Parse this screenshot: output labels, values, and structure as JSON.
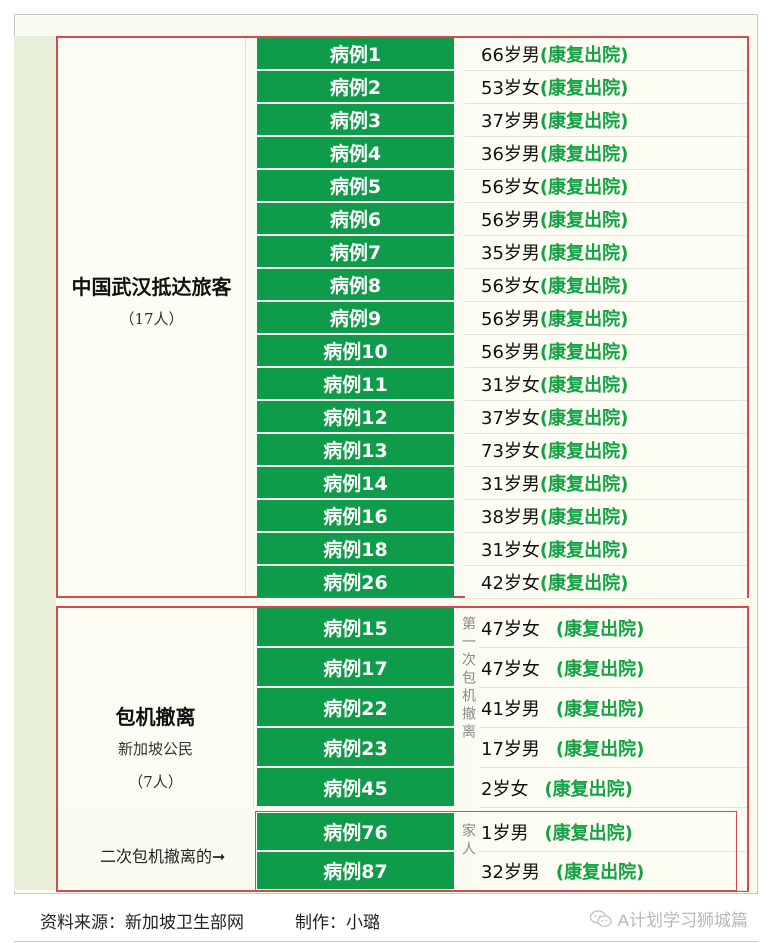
{
  "colors": {
    "accent_green": "#0e9c4a",
    "status_green": "#14a244",
    "border_red": "#d5494f"
  },
  "group1": {
    "title": "中国武汉抵达旅客",
    "count": "（17人）",
    "rows": [
      {
        "case": "病例1",
        "info": "66岁男",
        "status": "(康复出院)"
      },
      {
        "case": "病例2",
        "info": "53岁女",
        "status": "(康复出院)"
      },
      {
        "case": "病例3",
        "info": "37岁男",
        "status": "(康复出院)"
      },
      {
        "case": "病例4",
        "info": "36岁男",
        "status": "(康复出院)"
      },
      {
        "case": "病例5",
        "info": "56岁女",
        "status": "(康复出院)"
      },
      {
        "case": "病例6",
        "info": "56岁男",
        "status": "(康复出院)"
      },
      {
        "case": "病例7",
        "info": "35岁男",
        "status": "(康复出院)"
      },
      {
        "case": "病例8",
        "info": "56岁女",
        "status": "(康复出院)"
      },
      {
        "case": "病例9",
        "info": "56岁男",
        "status": "(康复出院)"
      },
      {
        "case": "病例10",
        "info": "56岁男",
        "status": "(康复出院)"
      },
      {
        "case": "病例11",
        "info": "31岁女",
        "status": "(康复出院)"
      },
      {
        "case": "病例12",
        "info": "37岁女",
        "status": "(康复出院)"
      },
      {
        "case": "病例13",
        "info": "73岁女",
        "status": "(康复出院)"
      },
      {
        "case": "病例14",
        "info": "31岁男",
        "status": "(康复出院)"
      },
      {
        "case": "病例16",
        "info": "38岁男",
        "status": "(康复出院)"
      },
      {
        "case": "病例18",
        "info": "31岁女",
        "status": "(康复出院)"
      },
      {
        "case": "病例26",
        "info": "42岁女",
        "status": "(康复出院)"
      }
    ]
  },
  "group2": {
    "title": "包机撤离",
    "subtitle": "新加坡公民",
    "count": "（7人）",
    "first_flight_note": "第一次包机撤离",
    "second_flight_label": "二次包机撤离的",
    "family_note": "家人",
    "rows": [
      {
        "case": "病例15",
        "info": "47岁女",
        "status": "(康复出院)"
      },
      {
        "case": "病例17",
        "info": "47岁女",
        "status": "(康复出院)"
      },
      {
        "case": "病例22",
        "info": "41岁男",
        "status": "(康复出院)"
      },
      {
        "case": "病例23",
        "info": "17岁男",
        "status": "(康复出院)"
      },
      {
        "case": "病例45",
        "info": "2岁女",
        "status": "(康复出院)"
      },
      {
        "case": "病例76",
        "info": "1岁男",
        "status": "(康复出院)"
      },
      {
        "case": "病例87",
        "info": "32岁男",
        "status": "(康复出院)"
      }
    ]
  },
  "footer": {
    "source": "资料来源：新加坡卫生部网　　　制作：小璐",
    "watermark": "A计划学习狮城篇",
    "watermark_icon": "wechat-icon"
  }
}
